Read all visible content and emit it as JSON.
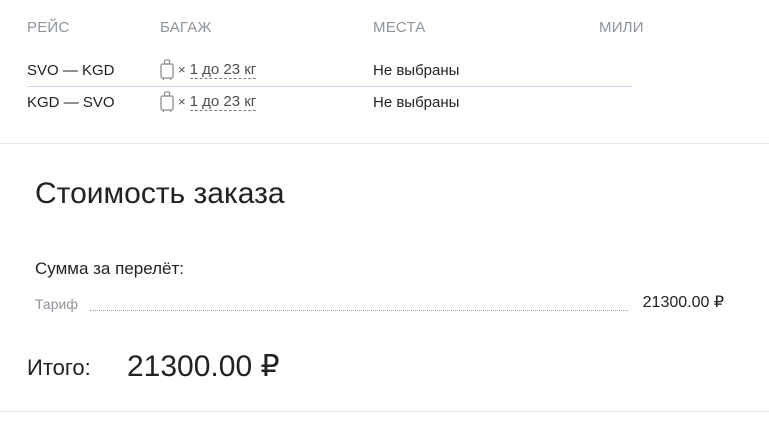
{
  "columns": {
    "flight": "РЕЙС",
    "baggage": "БАГАЖ",
    "seats": "МЕСТА",
    "miles": "МИЛИ"
  },
  "segments": [
    {
      "route": "SVO — KGD",
      "baggage_icon": "suitcase-icon",
      "baggage_multiplier": "×",
      "baggage_weight": "1 до 23 кг",
      "seats": "Не выбраны"
    },
    {
      "route": "KGD — SVO",
      "baggage_icon": "suitcase-icon",
      "baggage_multiplier": "×",
      "baggage_weight": "1 до 23 кг",
      "seats": "Не выбраны"
    }
  ],
  "order_cost": {
    "title": "Стоимость заказа",
    "flight_sum_label": "Сумма за перелёт:",
    "tariff_label": "Тариф",
    "tariff_price": "21300.00 ₽",
    "total_label": "Итого:",
    "total_price": "21300.00 ₽"
  },
  "colors": {
    "text": "#222222",
    "muted": "#8e959b",
    "separator": "#cfd8e6"
  }
}
